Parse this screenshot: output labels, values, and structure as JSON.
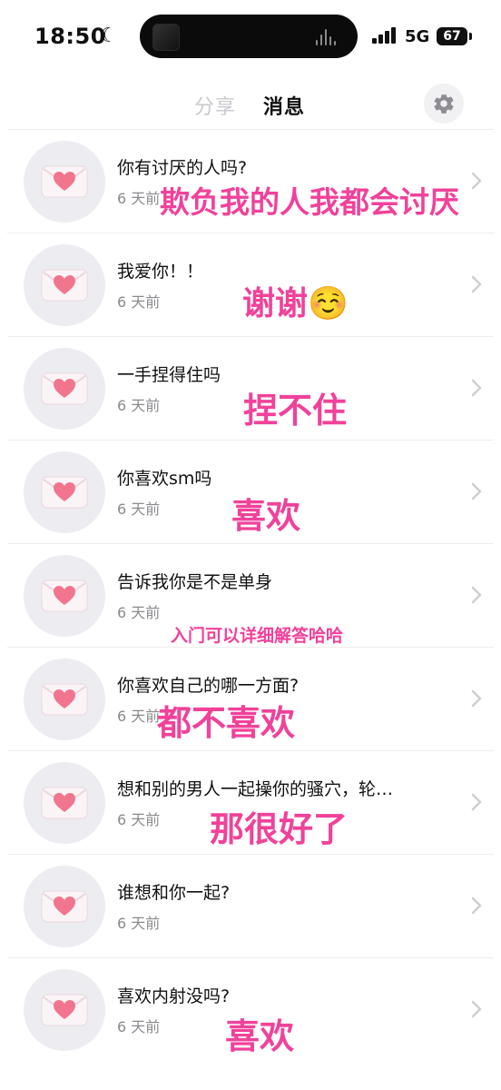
{
  "status_bar": {
    "time": "18:50",
    "network": "5G",
    "battery": "67"
  },
  "header": {
    "tabs": [
      {
        "label": "分享",
        "active": false
      },
      {
        "label": "消息",
        "active": true
      }
    ],
    "settings_icon": "gear-icon"
  },
  "colors": {
    "reply_pink": "#f0429a",
    "muted_gray": "#8a8a8f"
  },
  "messages": [
    {
      "question": "你有讨厌的人吗?",
      "time": "6 天前",
      "reply": "欺负我的人我都会讨厌"
    },
    {
      "question": "我爱你！！",
      "time": "6 天前",
      "reply": "谢谢☺️"
    },
    {
      "question": "一手捏得住吗",
      "time": "6 天前",
      "reply": "捏不住"
    },
    {
      "question": "你喜欢sm吗",
      "time": "6 天前",
      "reply": "喜欢"
    },
    {
      "question": "告诉我你是不是单身",
      "time": "6 天前",
      "reply": "入门可以详细解答哈哈"
    },
    {
      "question": "你喜欢自己的哪一方面?",
      "time": "6 天前",
      "reply": "都不喜欢"
    },
    {
      "question": "想和别的男人一起操你的骚穴，轮…",
      "time": "6 天前",
      "reply": "那很好了"
    },
    {
      "question": "谁想和你一起?",
      "time": "6 天前",
      "reply": ""
    },
    {
      "question": "喜欢内射没吗?",
      "time": "6 天前",
      "reply": "喜欢"
    }
  ]
}
